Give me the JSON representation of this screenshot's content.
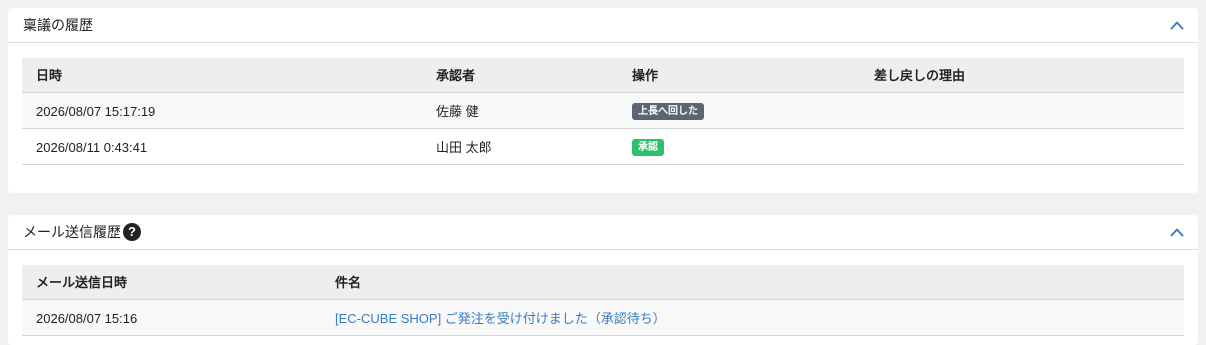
{
  "approval_history": {
    "title": "稟議の履歴",
    "columns": [
      "日時",
      "承認者",
      "操作",
      "差し戻しの理由"
    ],
    "rows": [
      {
        "datetime": "2026/08/07 15:17:19",
        "approver": "佐藤 健",
        "action": "上長へ回した",
        "action_color": "#5c6670",
        "reason": ""
      },
      {
        "datetime": "2026/08/11 0:43:41",
        "approver": "山田 太郎",
        "action": "承認",
        "action_color": "#2ebf6f",
        "reason": ""
      }
    ]
  },
  "mail_history": {
    "title": "メール送信履歴",
    "help_icon": "?",
    "columns": [
      "メール送信日時",
      "件名"
    ],
    "rows": [
      {
        "datetime": "2026/08/07 15:16",
        "subject": "[EC-CUBE SHOP] ご発注を受け付けました（承認待ち）"
      }
    ]
  },
  "colors": {
    "accent": "#3a7dc2",
    "badge_gray": "#5c6670",
    "badge_green": "#2ebf6f"
  }
}
